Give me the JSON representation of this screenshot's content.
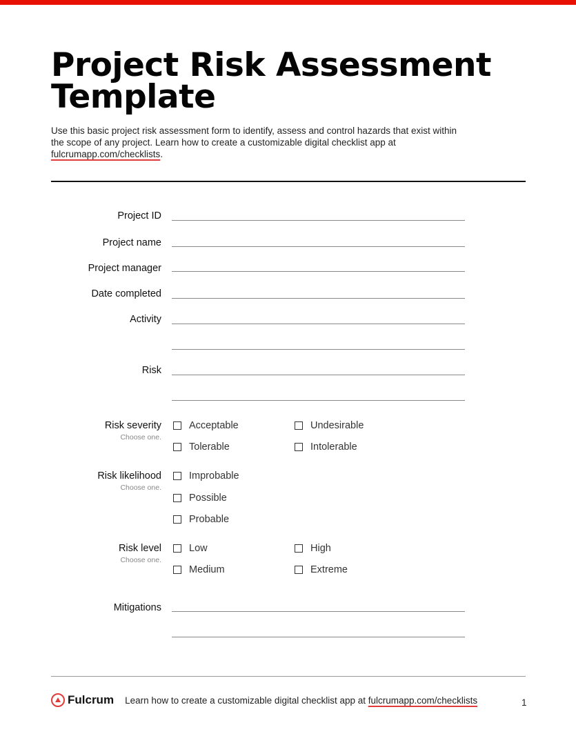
{
  "title_line1": "Project Risk Assessment",
  "title_line2": "Template",
  "intro": {
    "text": "Use this basic project risk assessment form to identify, assess and control hazards that exist within the scope of any project. Learn how to create a customizable digital checklist app at ",
    "link": "fulcrumapp.com/checklists",
    "after": "."
  },
  "fields": {
    "project_id": "Project ID",
    "project_name": "Project name",
    "project_manager": "Project manager",
    "date_completed": "Date completed",
    "activity": "Activity",
    "risk": "Risk",
    "mitigations": "Mitigations"
  },
  "risk_severity": {
    "label": "Risk severity",
    "hint": "Choose one.",
    "options": [
      "Acceptable",
      "Undesirable",
      "Tolerable",
      "Intolerable"
    ]
  },
  "risk_likelihood": {
    "label": "Risk likelihood",
    "hint": "Choose one.",
    "options": [
      "Improbable",
      "Possible",
      "Probable"
    ]
  },
  "risk_level": {
    "label": "Risk level",
    "hint": "Choose one.",
    "options": [
      "Low",
      "High",
      "Medium",
      "Extreme"
    ]
  },
  "footer": {
    "brand": "Fulcrum",
    "text": "Learn how to create a customizable digital checklist app at ",
    "link": "fulcrumapp.com/checklists",
    "page": "1"
  },
  "colors": {
    "accent": "#e81000"
  }
}
